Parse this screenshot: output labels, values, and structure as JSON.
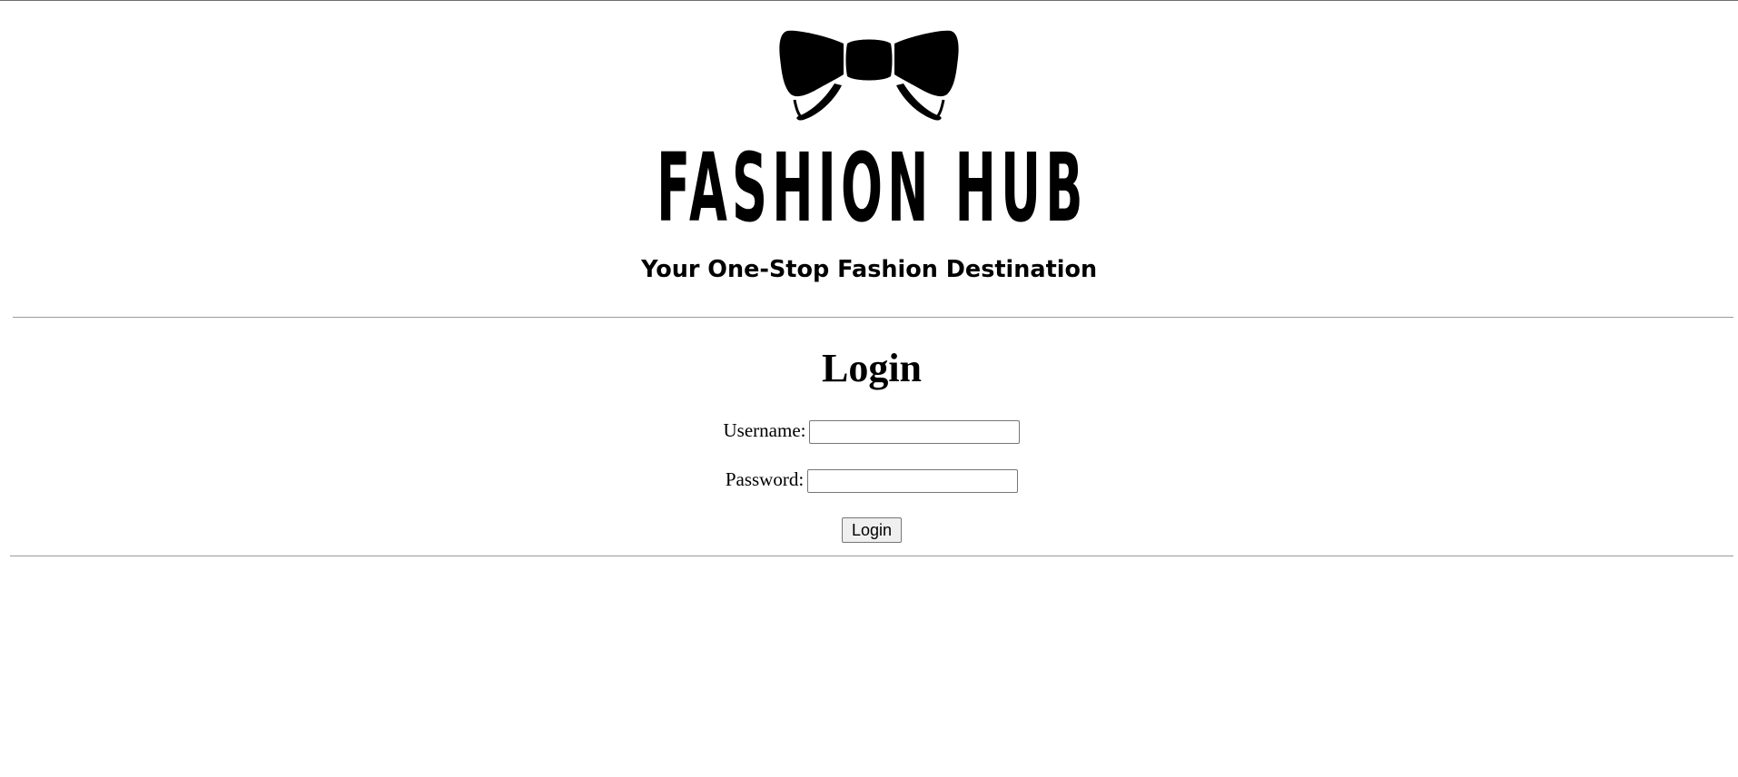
{
  "header": {
    "logo_icon": "bowtie-icon",
    "brand_name": "FASHION HUB",
    "tagline": "Your One-Stop Fashion Destination"
  },
  "login": {
    "heading": "Login",
    "username_label": "Username:",
    "username_value": "",
    "password_label": "Password:",
    "password_value": "",
    "submit_label": "Login"
  }
}
